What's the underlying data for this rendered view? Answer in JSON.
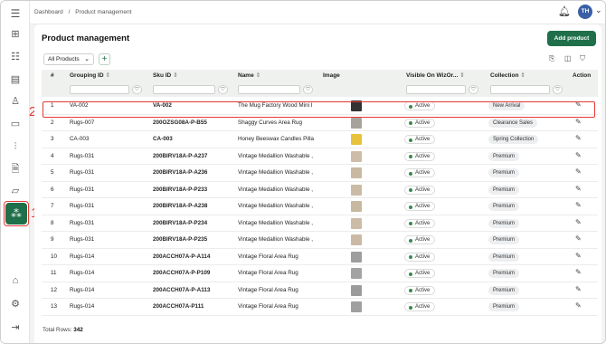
{
  "breadcrumb": {
    "root": "Dashboard",
    "sep": "/",
    "current": "Product management"
  },
  "user": {
    "initials": "TH"
  },
  "page": {
    "title": "Product management",
    "add_button": "Add product"
  },
  "filter": {
    "selected": "All Products"
  },
  "icons": {
    "sidebar": [
      "menu-icon",
      "catalog-icon",
      "list-icon",
      "document-icon",
      "user-icon",
      "chat-icon",
      "stats-icon",
      "file-lock-icon",
      "folder-icon",
      "product-group-icon",
      "store-icon",
      "settings-icon",
      "logout-icon"
    ]
  },
  "annotations": {
    "sidebar_marker": "1",
    "row_marker": "2"
  },
  "columns": {
    "num": "#",
    "grouping": "Grouping ID",
    "sku": "Sku ID",
    "name": "Name",
    "image": "Image",
    "visible": "Visible On WizOr...",
    "collection": "Collection",
    "action": "Action"
  },
  "rows": [
    {
      "n": "1",
      "grouping": "VA-002",
      "sku": "VA-002",
      "name": "The Mug Factory Wood Mini I",
      "visible": "Active",
      "collection": "New Arrival",
      "img": "#333"
    },
    {
      "n": "2",
      "grouping": "Rugs-007",
      "sku": "200OZSG08A-P-B55",
      "name": "Shaggy Curves Area Rug",
      "visible": "Active",
      "collection": "Clearance Sales",
      "img": "#a7a39c"
    },
    {
      "n": "3",
      "grouping": "CA-003",
      "sku": "CA-003",
      "name": "Honey Beeswax Candles Pilla",
      "visible": "Active",
      "collection": "Spring Collection",
      "img": "#e8c23a"
    },
    {
      "n": "4",
      "grouping": "Rugs-031",
      "sku": "200BIRV18A-P-A237",
      "name": "Vintage Medallion Washable ,",
      "visible": "Active",
      "collection": "Premium",
      "img": "#cdbda8"
    },
    {
      "n": "5",
      "grouping": "Rugs-031",
      "sku": "200BIRV18A-P-A236",
      "name": "Vintage Medallion Washable ,",
      "visible": "Active",
      "collection": "Premium",
      "img": "#c9b9a3"
    },
    {
      "n": "6",
      "grouping": "Rugs-031",
      "sku": "200BIRV18A-P-P233",
      "name": "Vintage Medallion Washable ,",
      "visible": "Active",
      "collection": "Premium",
      "img": "#cbbba6"
    },
    {
      "n": "7",
      "grouping": "Rugs-031",
      "sku": "200BIRV18A-P-A238",
      "name": "Vintage Medallion Washable ,",
      "visible": "Active",
      "collection": "Premium",
      "img": "#c8b8a2"
    },
    {
      "n": "8",
      "grouping": "Rugs-031",
      "sku": "200BIRV18A-P-P234",
      "name": "Vintage Medallion Washable ,",
      "visible": "Active",
      "collection": "Premium",
      "img": "#ccbca7"
    },
    {
      "n": "9",
      "grouping": "Rugs-031",
      "sku": "200BIRV18A-P-P235",
      "name": "Vintage Medallion Washable ,",
      "visible": "Active",
      "collection": "Premium",
      "img": "#cabaa5"
    },
    {
      "n": "10",
      "grouping": "Rugs-014",
      "sku": "200ACCH07A-P-A114",
      "name": "Vintage Floral Area Rug",
      "visible": "Active",
      "collection": "Premium",
      "img": "#9e9e9e"
    },
    {
      "n": "11",
      "grouping": "Rugs-014",
      "sku": "200ACCH07A-P-P109",
      "name": "Vintage Floral Area Rug",
      "visible": "Active",
      "collection": "Premium",
      "img": "#a3a3a3"
    },
    {
      "n": "12",
      "grouping": "Rugs-014",
      "sku": "200ACCH07A-P-A113",
      "name": "Vintage Floral Area Rug",
      "visible": "Active",
      "collection": "Premium",
      "img": "#9b9b9b"
    },
    {
      "n": "13",
      "grouping": "Rugs-014",
      "sku": "200ACCH07A-P111",
      "name": "Vintage Floral Area Rug",
      "visible": "Active",
      "collection": "Premium",
      "img": "#a0a0a0"
    }
  ],
  "footer": {
    "total_label": "Total Rows:",
    "total_value": "342"
  }
}
